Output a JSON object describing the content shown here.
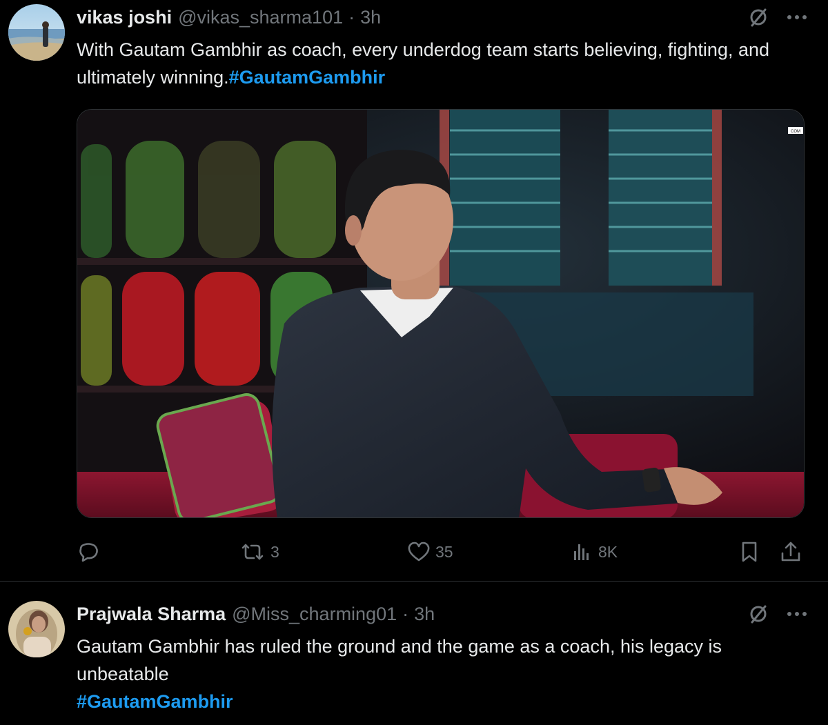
{
  "tweets": [
    {
      "name": "vikas joshi",
      "handle": "@vikas_sharma101",
      "separator": "·",
      "time": "3h",
      "text": "With Gautam Gambhir as coach, every underdog team starts believing, fighting, and ultimately winning.",
      "hashtag": "#GautamGambhir",
      "media_label": "COM",
      "stats": {
        "reposts": "3",
        "likes": "35",
        "views": "8K"
      }
    },
    {
      "name": "Prajwala Sharma",
      "handle": "@Miss_charming01",
      "separator": "·",
      "time": "3h",
      "text": "Gautam Gambhir has ruled the ground and the game as a coach, his legacy is unbeatable",
      "hashtag": "#GautamGambhir"
    }
  ],
  "colors": {
    "background": "#000000",
    "text": "#e7e9ea",
    "muted": "#71767b",
    "accent": "#1d9bf0",
    "divider": "#2f3336"
  },
  "icons": {
    "grok": "grok-icon",
    "more": "more-icon",
    "reply": "reply-icon",
    "repost": "repost-icon",
    "like": "heart-icon",
    "views": "views-icon",
    "bookmark": "bookmark-icon",
    "share": "share-icon"
  }
}
